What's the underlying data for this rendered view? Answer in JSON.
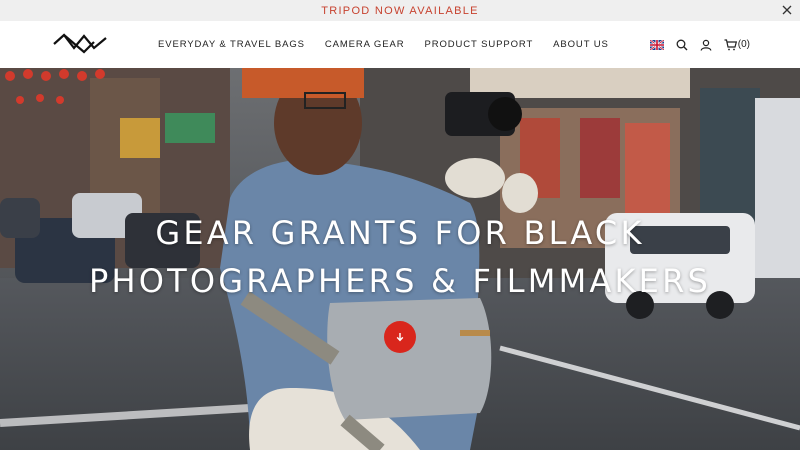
{
  "announcement": {
    "text": "TRIPOD NOW AVAILABLE"
  },
  "nav": {
    "items": [
      {
        "label": "EVERYDAY & TRAVEL BAGS"
      },
      {
        "label": "CAMERA GEAR"
      },
      {
        "label": "PRODUCT SUPPORT"
      },
      {
        "label": "ABOUT US"
      }
    ]
  },
  "utils": {
    "cart_count": "(0)",
    "locale": "uk-flag-icon"
  },
  "hero": {
    "line1": "GEAR GRANTS FOR BLACK",
    "line2": "PHOTOGRAPHERS & FILMMAKERS"
  },
  "colors": {
    "accent": "#c7422f",
    "scroll_button": "#d9261c"
  }
}
